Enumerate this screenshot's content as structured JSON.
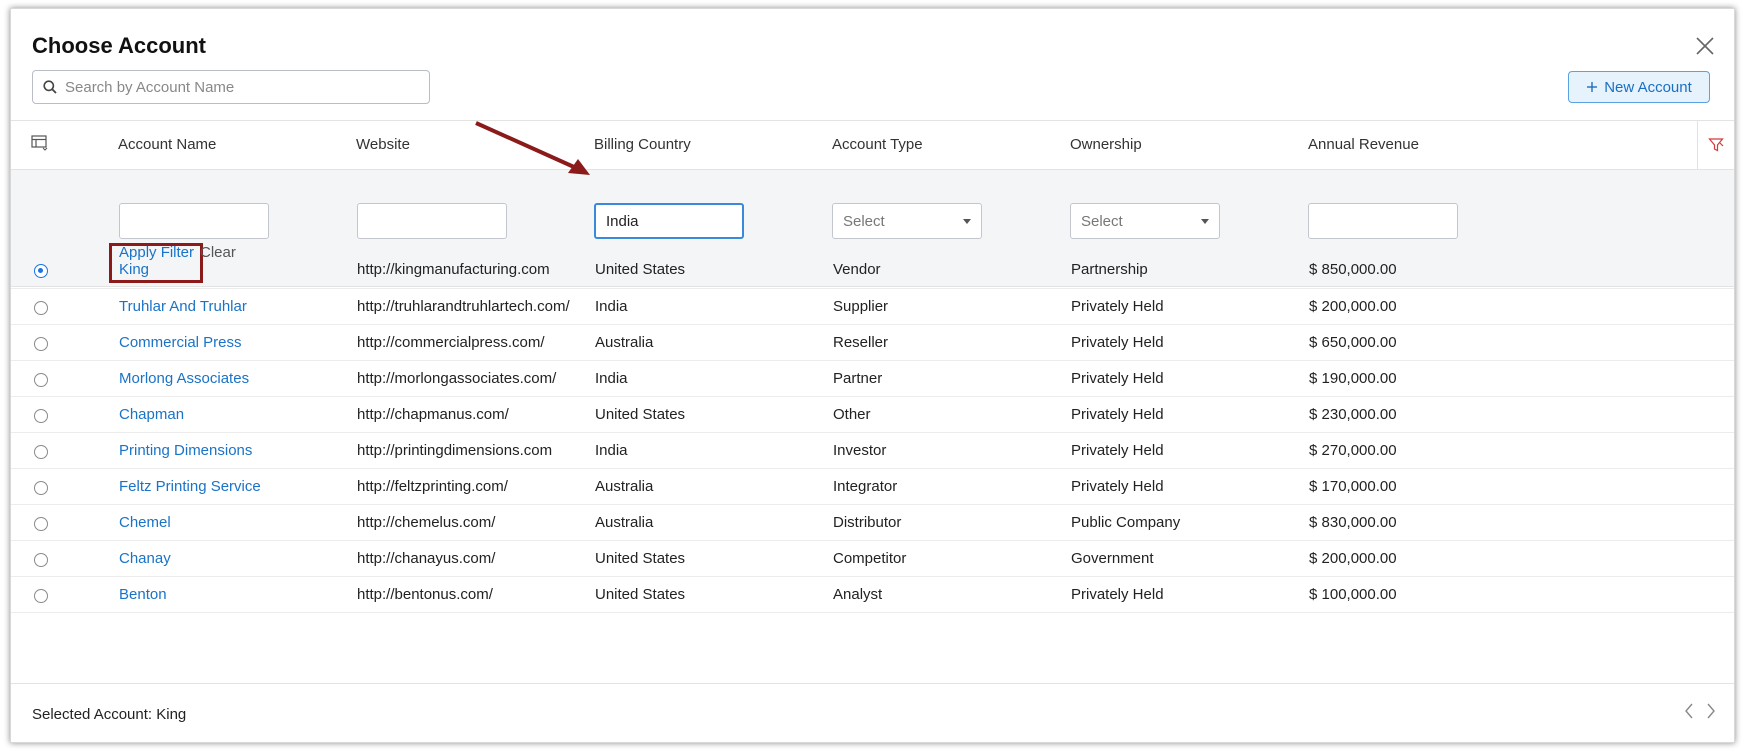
{
  "dialog": {
    "title": "Choose Account",
    "search_placeholder": "Search by Account Name",
    "new_account_label": "New Account"
  },
  "columns": [
    "Account Name",
    "Website",
    "Billing Country",
    "Account Type",
    "Ownership",
    "Annual Revenue"
  ],
  "filters": {
    "account_name": "",
    "website": "",
    "billing_country": "India",
    "account_type": "Select",
    "ownership": "Select",
    "annual_revenue": "",
    "apply_label": "Apply Filter",
    "clear_label": "Clear"
  },
  "rows": [
    {
      "selected": true,
      "name": "King",
      "website": "http://kingmanufacturing.com",
      "country": "United States",
      "type": "Vendor",
      "ownership": "Partnership",
      "revenue": "$ 850,000.00"
    },
    {
      "selected": false,
      "name": "Truhlar And Truhlar",
      "website": "http://truhlarandtruhlartech.com/",
      "country": "India",
      "type": "Supplier",
      "ownership": "Privately Held",
      "revenue": "$ 200,000.00"
    },
    {
      "selected": false,
      "name": "Commercial Press",
      "website": "http://commercialpress.com/",
      "country": "Australia",
      "type": "Reseller",
      "ownership": "Privately Held",
      "revenue": "$ 650,000.00"
    },
    {
      "selected": false,
      "name": "Morlong Associates",
      "website": "http://morlongassociates.com/",
      "country": "India",
      "type": "Partner",
      "ownership": "Privately Held",
      "revenue": "$ 190,000.00"
    },
    {
      "selected": false,
      "name": "Chapman",
      "website": "http://chapmanus.com/",
      "country": "United States",
      "type": "Other",
      "ownership": "Privately Held",
      "revenue": "$ 230,000.00"
    },
    {
      "selected": false,
      "name": "Printing Dimensions",
      "website": "http://printingdimensions.com",
      "country": "India",
      "type": "Investor",
      "ownership": "Privately Held",
      "revenue": "$ 270,000.00"
    },
    {
      "selected": false,
      "name": "Feltz Printing Service",
      "website": "http://feltzprinting.com/",
      "country": "Australia",
      "type": "Integrator",
      "ownership": "Privately Held",
      "revenue": "$ 170,000.00"
    },
    {
      "selected": false,
      "name": "Chemel",
      "website": "http://chemelus.com/",
      "country": "Australia",
      "type": "Distributor",
      "ownership": "Public Company",
      "revenue": "$ 830,000.00"
    },
    {
      "selected": false,
      "name": "Chanay",
      "website": "http://chanayus.com/",
      "country": "United States",
      "type": "Competitor",
      "ownership": "Government",
      "revenue": "$ 200,000.00"
    },
    {
      "selected": false,
      "name": "Benton",
      "website": "http://bentonus.com/",
      "country": "United States",
      "type": "Analyst",
      "ownership": "Privately Held",
      "revenue": "$ 100,000.00"
    }
  ],
  "footer": {
    "selected_text": "Selected Account: King"
  },
  "colors": {
    "link": "#1a73c7",
    "highlight_box": "#8b1a1a",
    "primary": "#1a73e8"
  }
}
